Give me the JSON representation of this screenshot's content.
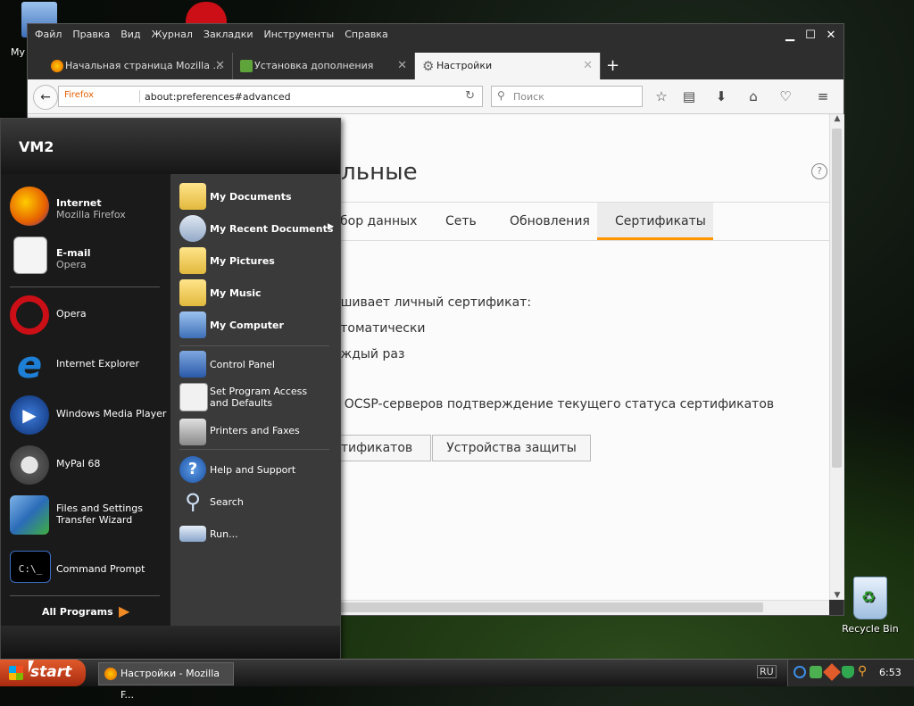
{
  "desktop": {
    "top_icon_label": "My",
    "recycle_bin_label": "Recycle Bin"
  },
  "firefox": {
    "menu": [
      "Файл",
      "Правка",
      "Вид",
      "Журнал",
      "Закладки",
      "Инструменты",
      "Справка"
    ],
    "tabs": [
      {
        "label": "Начальная страница Mozilla ...",
        "active": false
      },
      {
        "label": "Установка дополнения",
        "active": false
      },
      {
        "label": "Настройки",
        "active": true
      }
    ],
    "urlbar": {
      "identity": "Firefox",
      "url": "about:preferences#advanced"
    },
    "search_placeholder": "Поиск",
    "page": {
      "title_fragment": "тельные",
      "subtabs": [
        "бор данных",
        "Сеть",
        "Обновления",
        "Сертификаты"
      ],
      "selected_subtab": "Сертификаты",
      "line1": "ашивает личный сертификат:",
      "line2": "втоматически",
      "line3": "аждый раз",
      "line4": "у OCSP-серверов подтверждение текущего статуса сертификатов",
      "btn_certs": "тификатов",
      "btn_devices": "Устройства защиты"
    }
  },
  "start_menu": {
    "user": "VM2",
    "left_items": [
      {
        "title": "Internet",
        "subtitle": "Mozilla Firefox",
        "bold": true
      },
      {
        "title": "E-mail",
        "subtitle": "Opera",
        "bold": true
      },
      {
        "title": "Opera",
        "subtitle": "",
        "bold": false
      },
      {
        "title": "Internet Explorer",
        "subtitle": "",
        "bold": false
      },
      {
        "title": "Windows Media Player",
        "subtitle": "",
        "bold": false
      },
      {
        "title": "MyPal 68",
        "subtitle": "",
        "bold": false
      },
      {
        "title": "Files and Settings",
        "subtitle": "Transfer Wizard",
        "bold": false
      },
      {
        "title": "Command Prompt",
        "subtitle": "",
        "bold": false
      }
    ],
    "all_programs": "All Programs",
    "right_items": [
      {
        "title": "My Documents",
        "bold": true
      },
      {
        "title": "My Recent Documents",
        "bold": true
      },
      {
        "title": "My Pictures",
        "bold": true
      },
      {
        "title": "My Music",
        "bold": true
      },
      {
        "title": "My Computer",
        "bold": true
      },
      {
        "title": "Control Panel",
        "bold": false
      },
      {
        "title": "Set Program Access and Defaults",
        "bold": false
      },
      {
        "title": "Printers and Faxes",
        "bold": false
      },
      {
        "title": "Help and Support",
        "bold": false
      },
      {
        "title": "Search",
        "bold": false
      },
      {
        "title": "Run...",
        "bold": false
      }
    ]
  },
  "taskbar": {
    "start_label": "start",
    "task_item": "Настройки - Mozilla F...",
    "language": "RU",
    "clock": "6:53"
  }
}
